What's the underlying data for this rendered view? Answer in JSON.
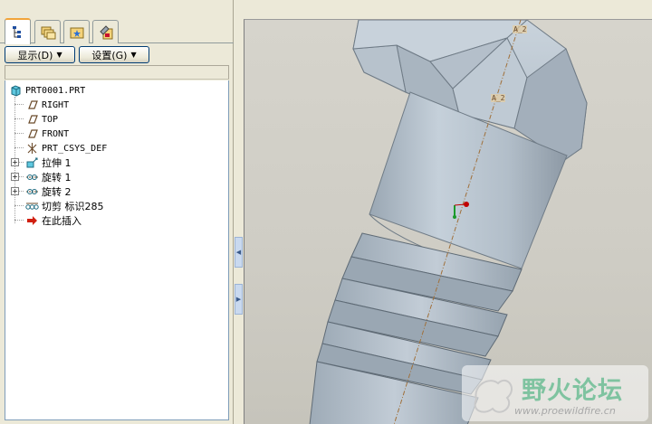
{
  "navigator": {
    "tabs": [
      {
        "name": "model-tree",
        "icon": "model-tree-icon",
        "active": true
      },
      {
        "name": "folder-browser",
        "icon": "folder-browser-icon",
        "active": false
      },
      {
        "name": "favorites",
        "icon": "favorites-icon",
        "active": false
      },
      {
        "name": "connections",
        "icon": "connections-icon",
        "active": false
      }
    ],
    "show_button": {
      "label": "显示(D)"
    },
    "settings_button": {
      "label": "设置(G)"
    },
    "tree": [
      {
        "label": "PRT0001.PRT",
        "icon": "part-icon",
        "expandable": false
      },
      {
        "label": "RIGHT",
        "icon": "datum-plane-icon",
        "expandable": false
      },
      {
        "label": "TOP",
        "icon": "datum-plane-icon",
        "expandable": false
      },
      {
        "label": "FRONT",
        "icon": "datum-plane-icon",
        "expandable": false
      },
      {
        "label": "PRT_CSYS_DEF",
        "icon": "coordinate-system-icon",
        "expandable": false
      },
      {
        "label": "拉伸 1",
        "icon": "extrude-icon",
        "expandable": true
      },
      {
        "label": "旋转 1",
        "icon": "revolve-icon",
        "expandable": true
      },
      {
        "label": "旋转 2",
        "icon": "revolve-icon",
        "expandable": true
      },
      {
        "label": "切剪 标识285",
        "icon": "cut-sweep-icon",
        "expandable": false
      },
      {
        "label": "在此插入",
        "icon": "insert-here-arrow-icon",
        "expandable": false
      }
    ]
  },
  "viewport": {
    "axis_labels": [
      "A_2",
      "A_2"
    ],
    "watermark": {
      "text": "野火论坛",
      "url": "www.proewildfire.cn"
    }
  },
  "colors": {
    "bolt": "#b8c4cf",
    "bolt_shadow": "#8a97a3",
    "background": "#d6d4cc",
    "axis": "#a0703a",
    "selection_tab": "#f2a43a"
  }
}
